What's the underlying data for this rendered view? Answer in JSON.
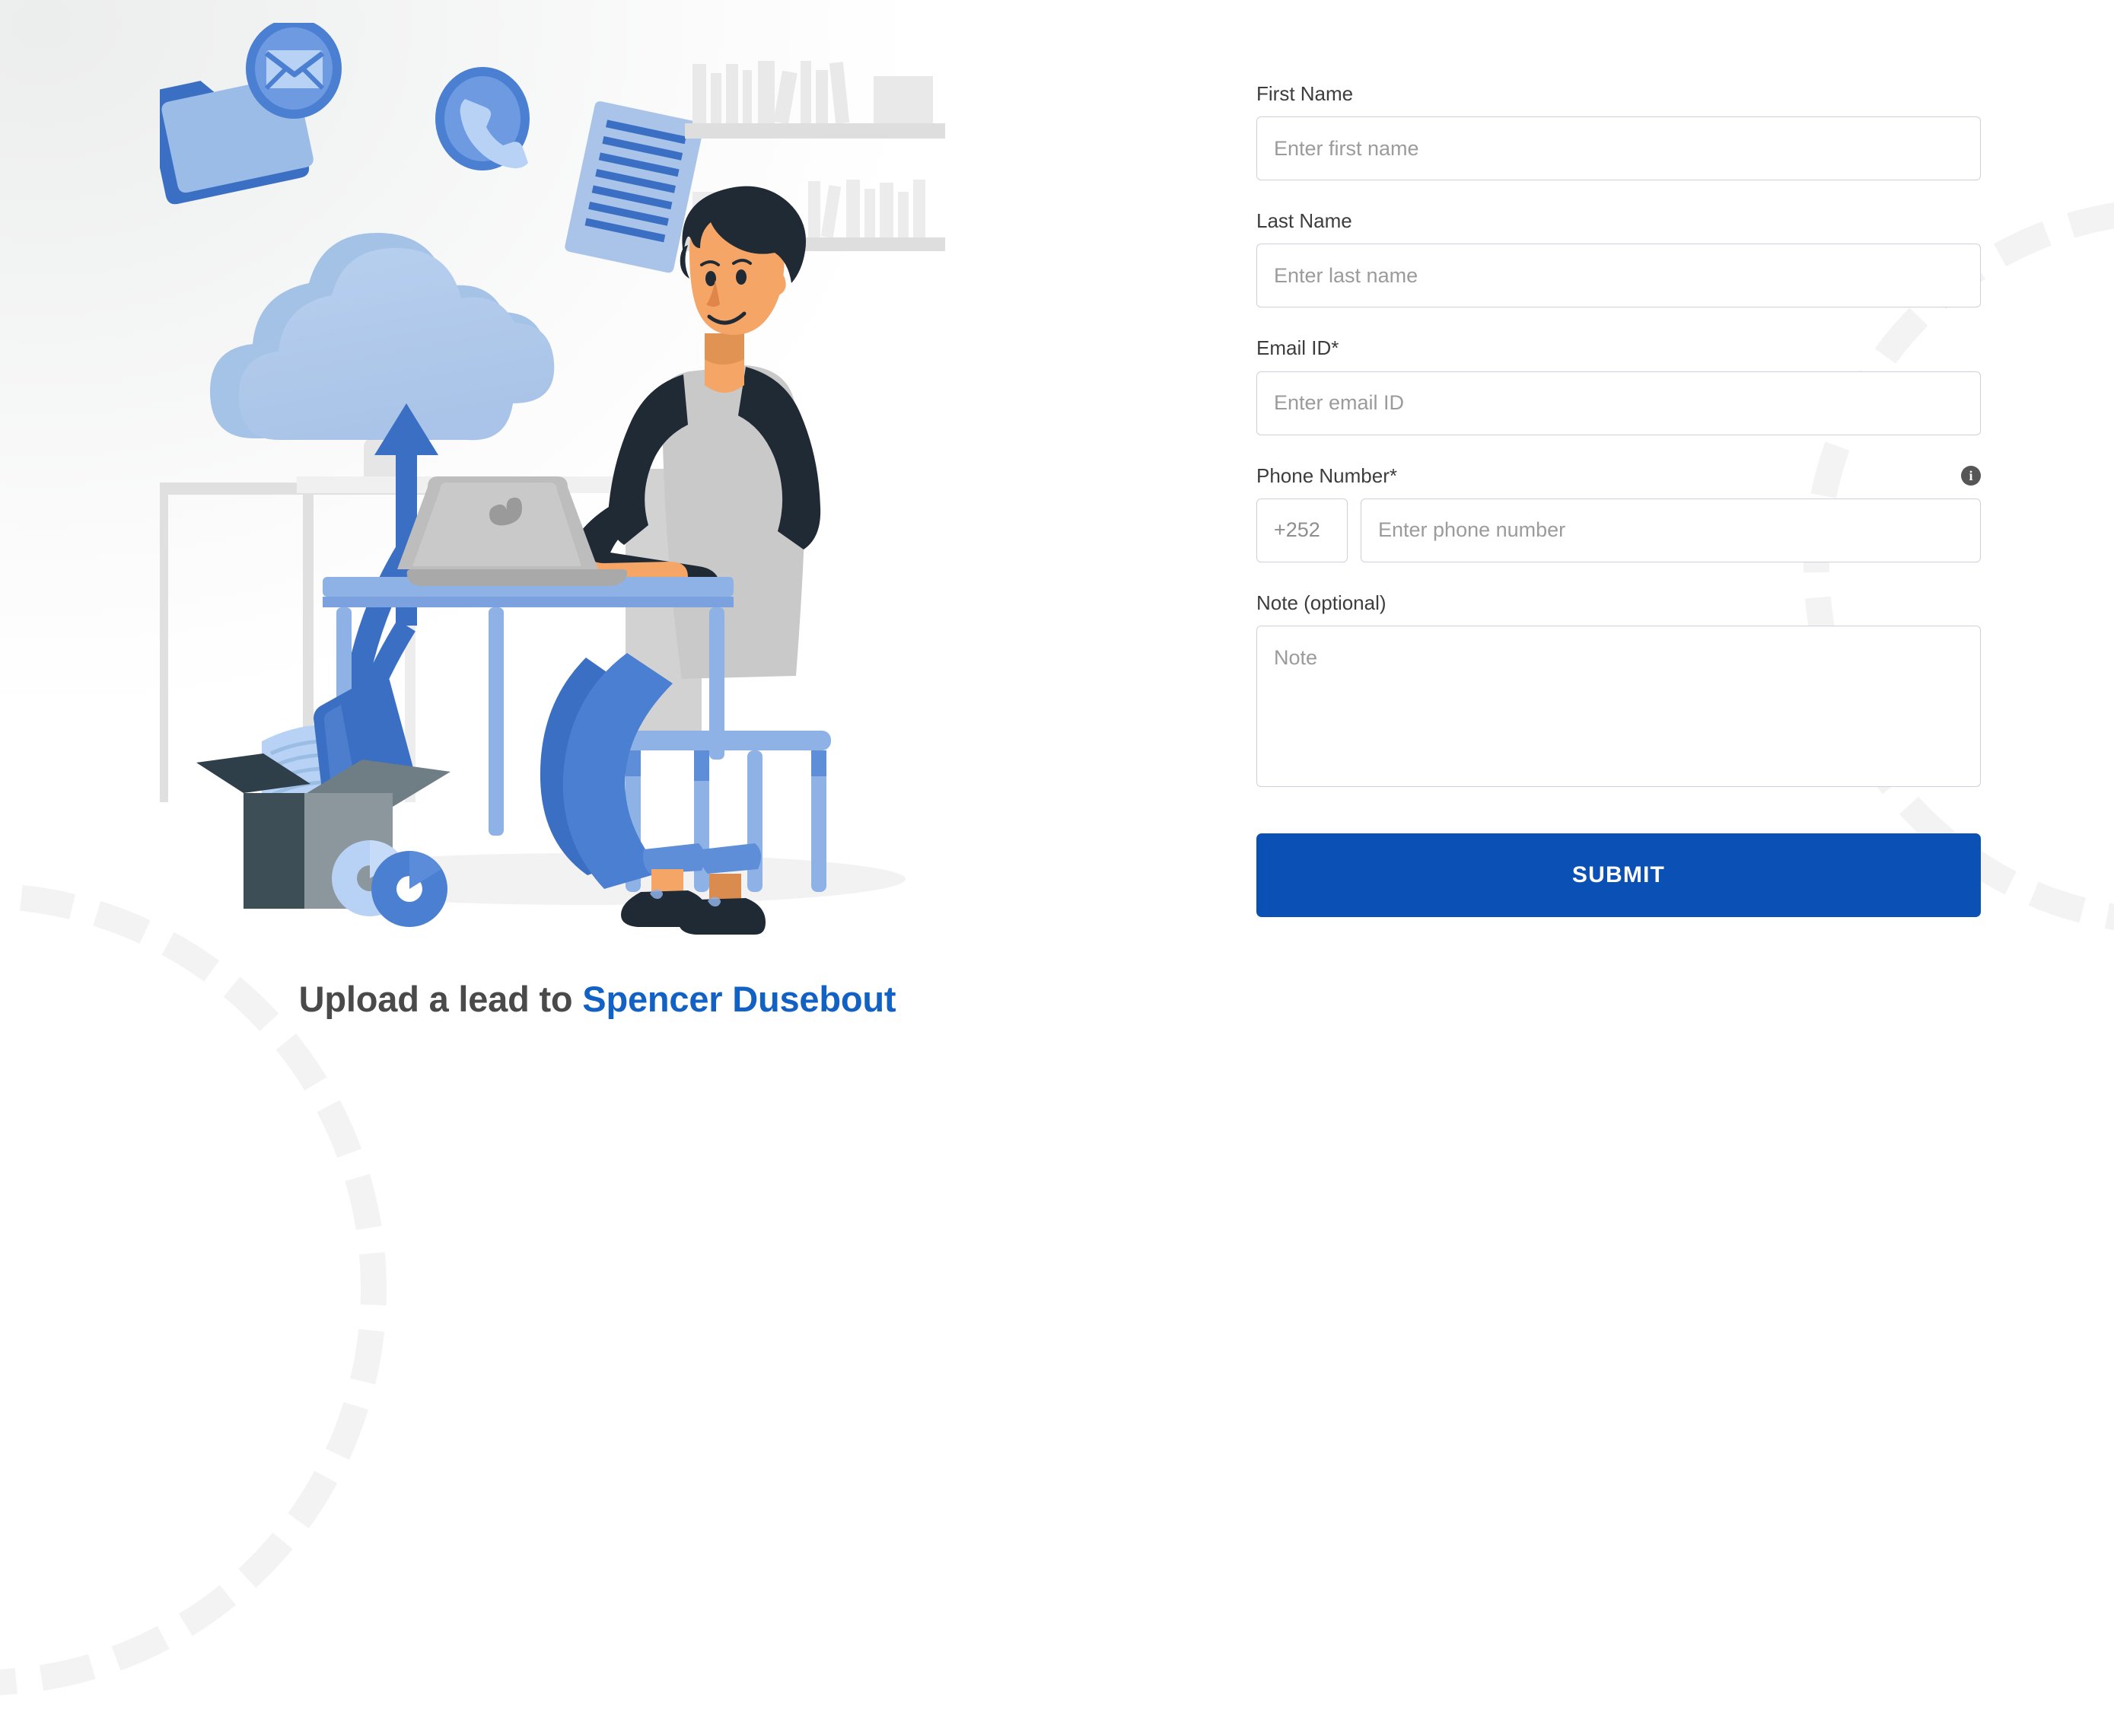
{
  "colors": {
    "accent_blue": "#1261c4",
    "submit_blue": "#0b50b4",
    "label_gray": "#3d3d3d",
    "placeholder_gray": "#9b9b9b",
    "border_gray": "#ccd1dd",
    "heading_gray": "#4a4a4a"
  },
  "illustration": {
    "alt": "person at desk uploading files to cloud",
    "icons": [
      "envelope-icon",
      "phone-icon",
      "folder-icon",
      "document-icon",
      "cloud-icon",
      "upload-arrow-icon",
      "laptop-icon",
      "bookshelf",
      "plant",
      "box-with-files",
      "compact-discs"
    ]
  },
  "headline": {
    "prefix": "Upload a lead to ",
    "name": "Spencer Dusebout"
  },
  "form": {
    "fields": [
      {
        "label": "First Name",
        "placeholder": "Enter first name"
      },
      {
        "label": "Last Name",
        "placeholder": "Enter last name"
      },
      {
        "label": "Email ID*",
        "placeholder": "Enter email ID"
      }
    ],
    "phone": {
      "label": "Phone Number*",
      "country_code": "+252",
      "placeholder": "Enter phone number",
      "info_icon": "info-icon",
      "info_glyph": "i"
    },
    "note": {
      "label": "Note (optional)",
      "placeholder": "Note"
    },
    "submit_label": "SUBMIT"
  }
}
